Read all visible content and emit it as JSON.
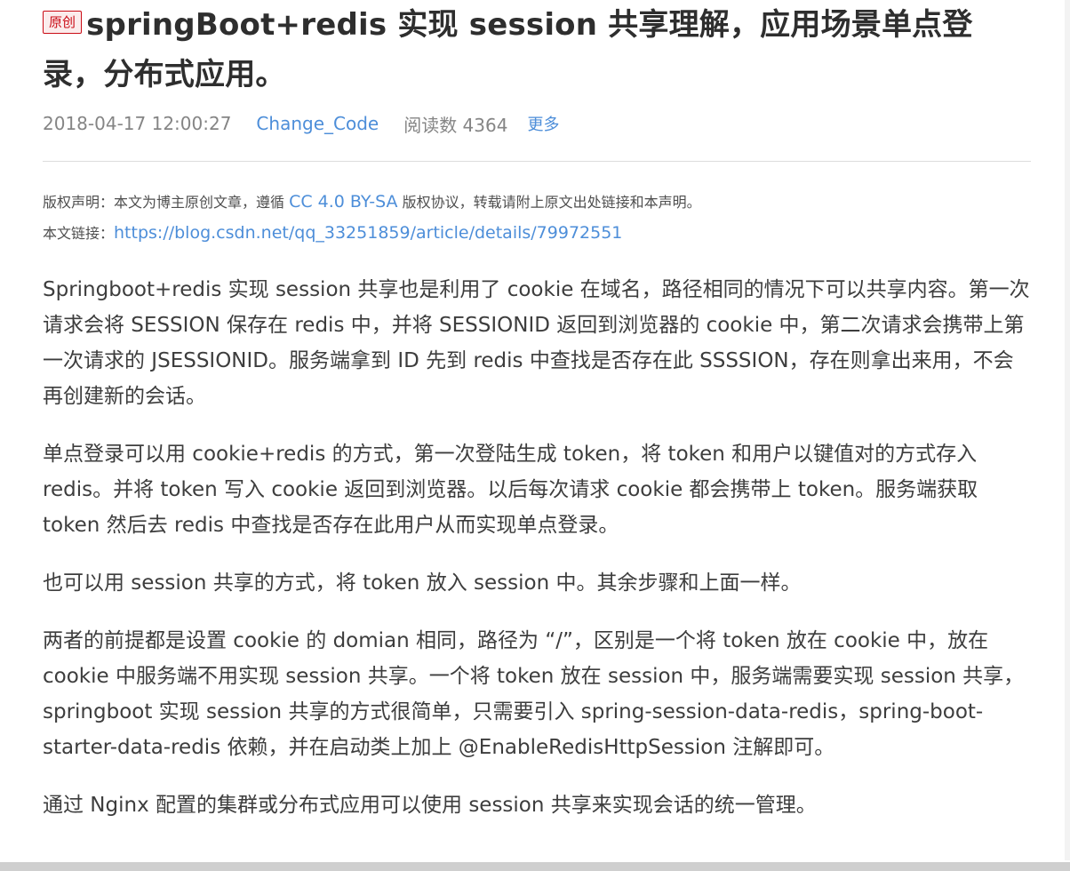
{
  "article": {
    "badge": "原创",
    "title": "springBoot+redis 实现 session 共享理解，应用场景单点登录，分布式应用。",
    "meta": {
      "time": "2018-04-17 12:00:27",
      "author": "Change_Code",
      "reads": "阅读数 4364",
      "more": "更多"
    },
    "copyright": {
      "prefix": "版权声明：本文为博主原创文章，遵循 ",
      "license": "CC 4.0 BY-SA",
      "suffix": " 版权协议，转载请附上原文出处链接和本声明。",
      "link_label": "本文链接：",
      "link_url": "https://blog.csdn.net/qq_33251859/article/details/79972551"
    },
    "paragraphs": [
      "Springboot+redis 实现 session 共享也是利用了 cookie 在域名，路径相同的情况下可以共享内容。第一次请求会将 SESSION 保存在 redis 中，并将 SESSIONID 返回到浏览器的 cookie 中，第二次请求会携带上第一次请求的 JSESSIONID。服务端拿到 ID 先到 redis 中查找是否存在此 SSSSION，存在则拿出来用，不会再创建新的会话。",
      "单点登录可以用 cookie+redis 的方式，第一次登陆生成 token，将 token 和用户以键值对的方式存入 redis。并将 token 写入 cookie 返回到浏览器。以后每次请求 cookie 都会携带上 token。服务端获取 token 然后去 redis 中查找是否存在此用户从而实现单点登录。",
      "也可以用 session 共享的方式，将 token 放入 session 中。其余步骤和上面一样。",
      "两者的前提都是设置 cookie 的 domian 相同，路径为 “/”，区别是一个将 token 放在 cookie 中，放在 cookie 中服务端不用实现 session 共享。一个将 token 放在 session 中，服务端需要实现 session 共享，springboot 实现 session 共享的方式很简单，只需要引入 spring-session-data-redis，spring-boot-starter-data-redis 依赖，并在启动类上加上 @EnableRedisHttpSession 注解即可。",
      "通过 Nginx 配置的集群或分布式应用可以使用 session 共享来实现会话的统一管理。"
    ]
  }
}
